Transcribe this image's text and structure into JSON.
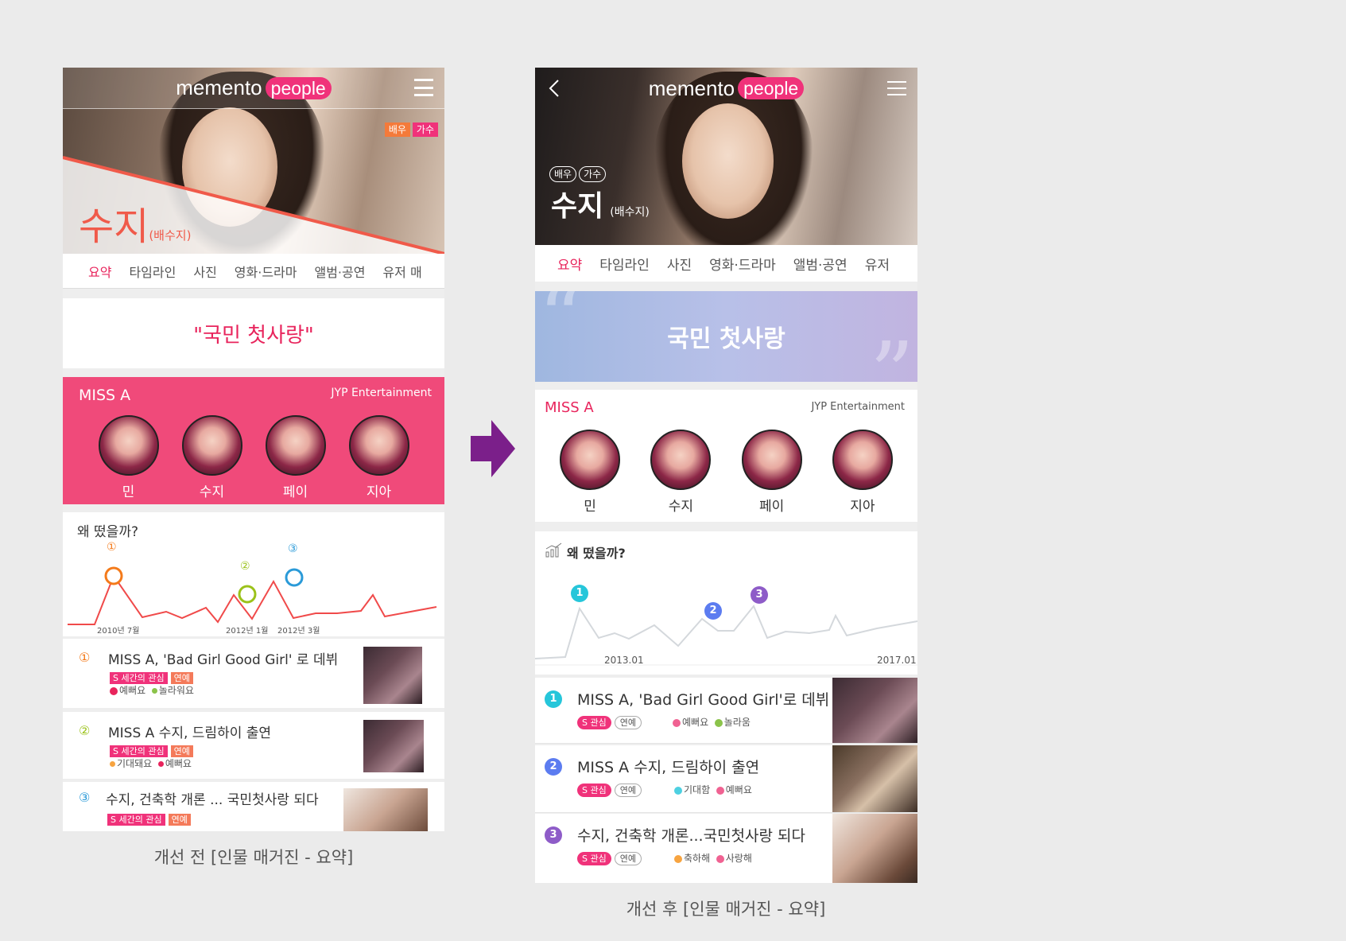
{
  "before": {
    "logo_text": "memento",
    "logo_pill": "people",
    "tags": [
      "배우",
      "가수"
    ],
    "name": "수지",
    "real_name": "(배수지)",
    "tabs": [
      "요약",
      "타임라인",
      "사진",
      "영화·드라마",
      "앨범·공연",
      "유저 매"
    ],
    "quote": "\"국민 첫사랑\"",
    "group": {
      "name": "MISS A",
      "agency": "JYP Entertainment",
      "members": [
        "민",
        "수지",
        "페이",
        "지아"
      ]
    },
    "why": {
      "title": "왜 떴을까?",
      "x_labels": [
        "2010년 7월",
        "2012년 1월",
        "2012년 3월"
      ],
      "markers": [
        "①",
        "②",
        "③"
      ]
    },
    "items": [
      {
        "num": "①",
        "title": "MISS A, 'Bad Girl Good Girl' 로 데뷔",
        "badges": [
          "S 세간의 관심",
          "연예"
        ],
        "reacts": [
          "예뻐요",
          "놀라워요"
        ],
        "react_colors": [
          "#e8245c",
          "#8bc34a"
        ]
      },
      {
        "num": "②",
        "title": "MISS A 수지, 드림하이 출연",
        "badges": [
          "S 세간의 관심",
          "연예"
        ],
        "reacts": [
          "기대돼요",
          "예뻐요"
        ],
        "react_colors": [
          "#f7a440",
          "#e8245c"
        ]
      },
      {
        "num": "③",
        "title": "수지, 건축학 개론 ... 국민첫사랑 되다",
        "badges": [
          "S 세간의 관심",
          "연예"
        ],
        "reacts": [],
        "react_colors": []
      }
    ],
    "caption": "개선 전 [인물 매거진 - 요약]"
  },
  "after": {
    "logo_text": "memento",
    "logo_pill": "people",
    "tags": [
      "배우",
      "가수"
    ],
    "name": "수지",
    "real_name": "(배수지)",
    "tabs": [
      "요약",
      "타임라인",
      "사진",
      "영화·드라마",
      "앨범·공연",
      "유저"
    ],
    "quote": "국민 첫사랑",
    "group": {
      "name": "MISS A",
      "agency": "JYP Entertainment",
      "members": [
        "민",
        "수지",
        "페이",
        "지아"
      ]
    },
    "why": {
      "title": "왜 떴을까?",
      "x_labels": [
        "2013.01",
        "2017.01"
      ],
      "markers": [
        "1",
        "2",
        "3"
      ]
    },
    "items": [
      {
        "num": "1",
        "title": "MISS A, 'Bad Girl Good Girl'로 데뷔",
        "badges": [
          "S 관심",
          "연예"
        ],
        "reacts": [
          "예뻐요",
          "놀라움"
        ],
        "react_colors": [
          "#f06292",
          "#8bc34a"
        ]
      },
      {
        "num": "2",
        "title": "MISS A 수지, 드림하이 출연",
        "badges": [
          "S 관심",
          "연예"
        ],
        "reacts": [
          "기대함",
          "예뻐요"
        ],
        "react_colors": [
          "#4dd0e1",
          "#f06292"
        ]
      },
      {
        "num": "3",
        "title": "수지, 건축학 개론...국민첫사랑 되다",
        "badges": [
          "S 관심",
          "연예"
        ],
        "reacts": [
          "축하해",
          "사랑해"
        ],
        "react_colors": [
          "#f7a440",
          "#f06292"
        ]
      }
    ],
    "caption": "개선 후 [인물 매거진 - 요약]"
  },
  "colors": {
    "accent": "#e8245c",
    "pink_bg": "#f04a7a",
    "teal": "#26c6da",
    "blue": "#5c7cf0",
    "purple": "#8e5cc8",
    "arrow": "#7b1f8a"
  }
}
